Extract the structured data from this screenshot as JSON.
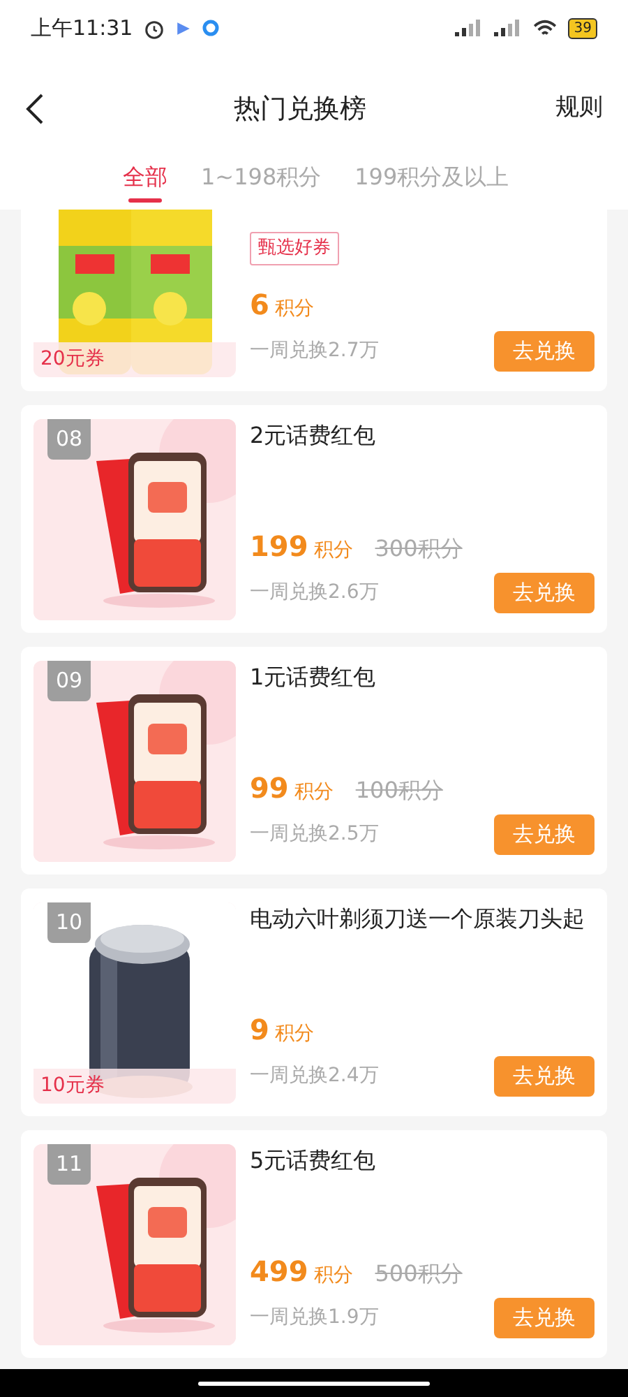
{
  "status_bar": {
    "time": "上午11:31",
    "battery": "39"
  },
  "header": {
    "title": "热门兑换榜",
    "action": "规则"
  },
  "tabs": [
    {
      "label": "全部",
      "selected": true
    },
    {
      "label": "1~198积分",
      "selected": false
    },
    {
      "label": "199积分及以上",
      "selected": false
    }
  ],
  "items": [
    {
      "tag": "甄选好券",
      "points": "6",
      "unit": "积分",
      "weekly": "一周兑换2.7万",
      "button": "去兑换",
      "coupon": "20元券"
    },
    {
      "rank": "08",
      "title": "2元话费红包",
      "points": "199",
      "unit": "积分",
      "original": "300积分",
      "weekly": "一周兑换2.6万",
      "button": "去兑换"
    },
    {
      "rank": "09",
      "title": "1元话费红包",
      "points": "99",
      "unit": "积分",
      "original": "100积分",
      "weekly": "一周兑换2.5万",
      "button": "去兑换"
    },
    {
      "rank": "10",
      "title": "电动六叶剃须刀送一个原装刀头起",
      "points": "9",
      "unit": "积分",
      "weekly": "一周兑换2.4万",
      "button": "去兑换",
      "coupon": "10元券"
    },
    {
      "rank": "11",
      "title": "5元话费红包",
      "points": "499",
      "unit": "积分",
      "original": "500积分",
      "weekly": "一周兑换1.9万",
      "button": "去兑换"
    }
  ]
}
